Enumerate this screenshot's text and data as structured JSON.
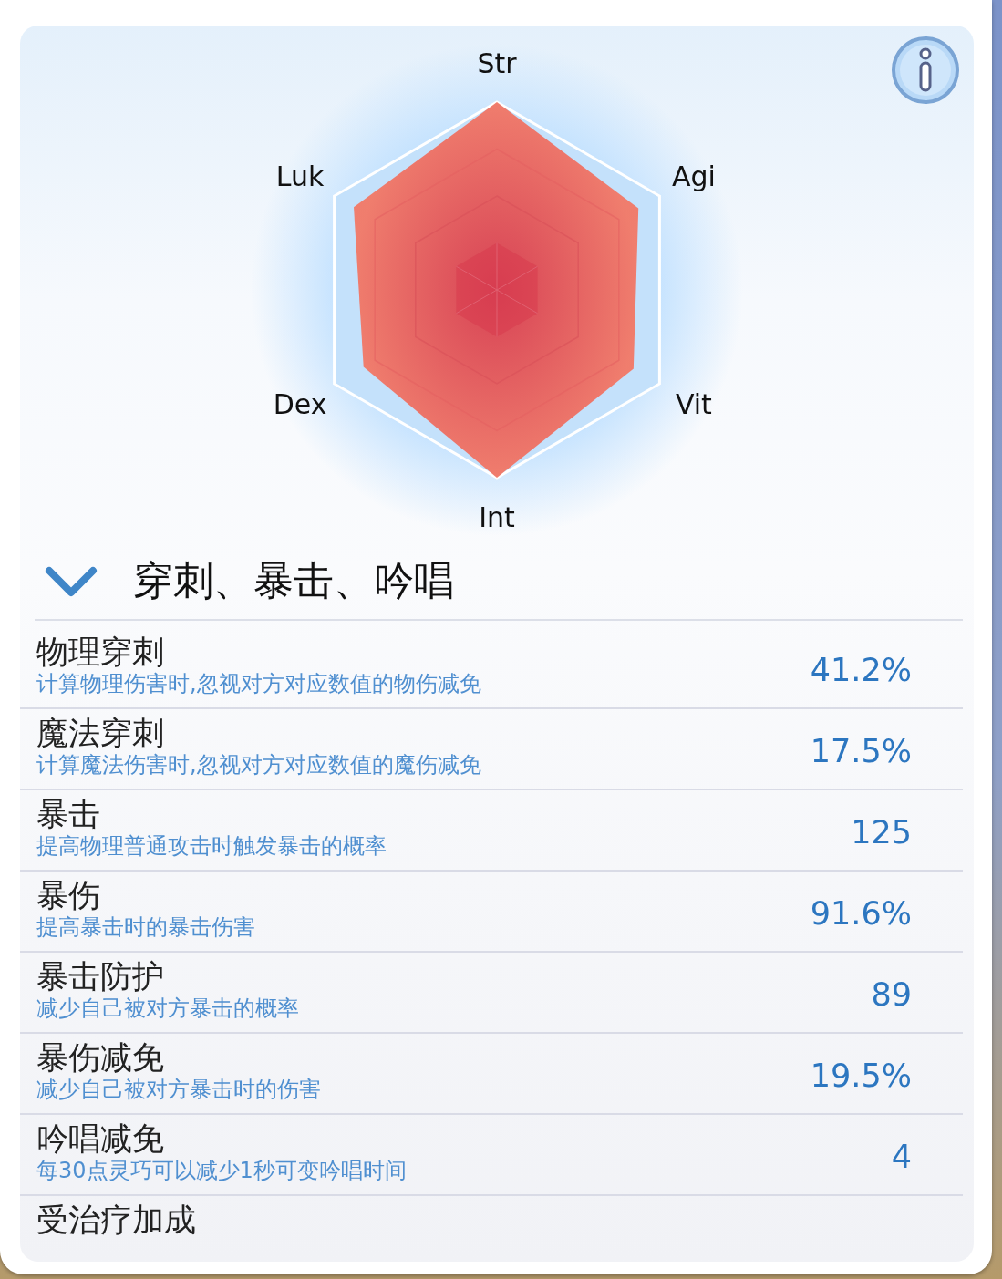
{
  "radar": {
    "axes": [
      "Str",
      "Agi",
      "Vit",
      "Int",
      "Dex",
      "Luk"
    ]
  },
  "section": {
    "title": "穿刺、暴击、吟唱",
    "expanded": true
  },
  "stats": [
    {
      "name": "物理穿刺",
      "description": "计算物理伤害时,忽视对方对应数值的物伤减免",
      "value": "41.2%"
    },
    {
      "name": "魔法穿刺",
      "description": "计算魔法伤害时,忽视对方对应数值的魔伤减免",
      "value": "17.5%"
    },
    {
      "name": "暴击",
      "description": "提高物理普通攻击时触发暴击的概率",
      "value": "125"
    },
    {
      "name": "暴伤",
      "description": "提高暴击时的暴击伤害",
      "value": "91.6%"
    },
    {
      "name": "暴击防护",
      "description": "减少自己被对方暴击的概率",
      "value": "89"
    },
    {
      "name": "暴伤减免",
      "description": "减少自己被对方暴击时的伤害",
      "value": "19.5%"
    },
    {
      "name": "吟唱减免",
      "description": "每30点灵巧可以减少1秒可变吟唱时间",
      "value": "4"
    },
    {
      "name": "受治疗加成"
    }
  ]
}
